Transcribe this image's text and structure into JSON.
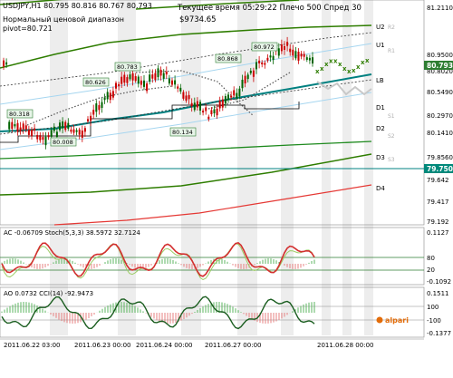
{
  "header": {
    "symbol_line": "USDJPY,H1  80.795 80.816 80.767 80.793",
    "subtitle_1": "Нормальный ценовой диапазон",
    "subtitle_2": "pivot=80.721",
    "server_time": "Текущее время 05:29:22  Плечо 500  Спред 30",
    "balance": "$9734.65"
  },
  "price_axis": {
    "labels": [
      "81.2110",
      "80.9500",
      "80.8020",
      "80.5490",
      "80.2970",
      "80.1410",
      "79.8560",
      "79.750",
      "79.642",
      "79.417",
      "79.192"
    ],
    "current_price": "80.793",
    "current_price_color": "#2e7d32",
    "level_price": "79.750",
    "level_price_color": "#00897b"
  },
  "levels": {
    "U2": "U2",
    "U1": "U1",
    "LB": "LB",
    "D1": "D1",
    "D2": "D2",
    "D3": "D3",
    "D4": "D4",
    "r2": "R2",
    "r1": "R1",
    "s1": "S1",
    "s2": "S2",
    "s3": "S3"
  },
  "price_tags": [
    "80.318",
    "80.008",
    "80.626",
    "80.783",
    "80.134",
    "80.868",
    "80.972"
  ],
  "ac_panel": {
    "title": "AC -0.06709  Stoch(5,3,3) 38.5972 32.7124",
    "axis": [
      "0.1127",
      "80",
      "20",
      "-0.1092"
    ]
  },
  "ao_panel": {
    "title": "AO 0.0732  CCI(14) -92.9473",
    "axis": [
      "0.1511",
      "100",
      "-100",
      "-0.1377"
    ]
  },
  "brand": "alpari",
  "time_axis": [
    "2011.06.22 03:00",
    "2011.06.23 00:00",
    "2011.06.24 00:00",
    "2011.06.27 00:00",
    "2011.06.28 00:00"
  ],
  "colors": {
    "bull": "#006400",
    "bear": "#cc0000",
    "trend_green": "#2e7d00",
    "trend_teal": "#008080",
    "red_line": "#e53935"
  }
}
